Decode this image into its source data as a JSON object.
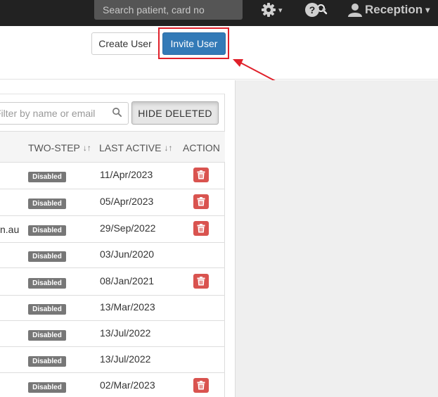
{
  "navbar": {
    "search_placeholder": "Search patient, card no",
    "user_label": "Reception",
    "icons": [
      "gear-icon",
      "help-icon",
      "user-icon"
    ]
  },
  "header": {
    "create_user_label": "Create User",
    "invite_user_label": "Invite User"
  },
  "toolbar": {
    "filter_placeholder": "Filter by name or email",
    "hide_deleted_label": "HIDE DELETED"
  },
  "table": {
    "columns": [
      "TWO-STEP",
      "LAST ACTIVE",
      "ACTION"
    ],
    "rows": [
      {
        "email_tail": "",
        "two_step": "Disabled",
        "last_active": "11/Apr/2023",
        "deletable": true
      },
      {
        "email_tail": "",
        "two_step": "Disabled",
        "last_active": "05/Apr/2023",
        "deletable": true
      },
      {
        "email_tail": "n.au",
        "two_step": "Disabled",
        "last_active": "29/Sep/2022",
        "deletable": true
      },
      {
        "email_tail": "",
        "two_step": "Disabled",
        "last_active": "03/Jun/2020",
        "deletable": false
      },
      {
        "email_tail": "",
        "two_step": "Disabled",
        "last_active": "08/Jan/2021",
        "deletable": true
      },
      {
        "email_tail": "",
        "two_step": "Disabled",
        "last_active": "13/Mar/2023",
        "deletable": false
      },
      {
        "email_tail": "",
        "two_step": "Disabled",
        "last_active": "13/Jul/2022",
        "deletable": false
      },
      {
        "email_tail": "",
        "two_step": "Disabled",
        "last_active": "13/Jul/2022",
        "deletable": false
      },
      {
        "email_tail": "",
        "two_step": "Disabled",
        "last_active": "02/Mar/2023",
        "deletable": true
      }
    ]
  },
  "colors": {
    "navbar": "#222222",
    "primary": "#337ab7",
    "danger": "#d9534f",
    "badge": "#777777",
    "highlight": "#e0202a"
  }
}
